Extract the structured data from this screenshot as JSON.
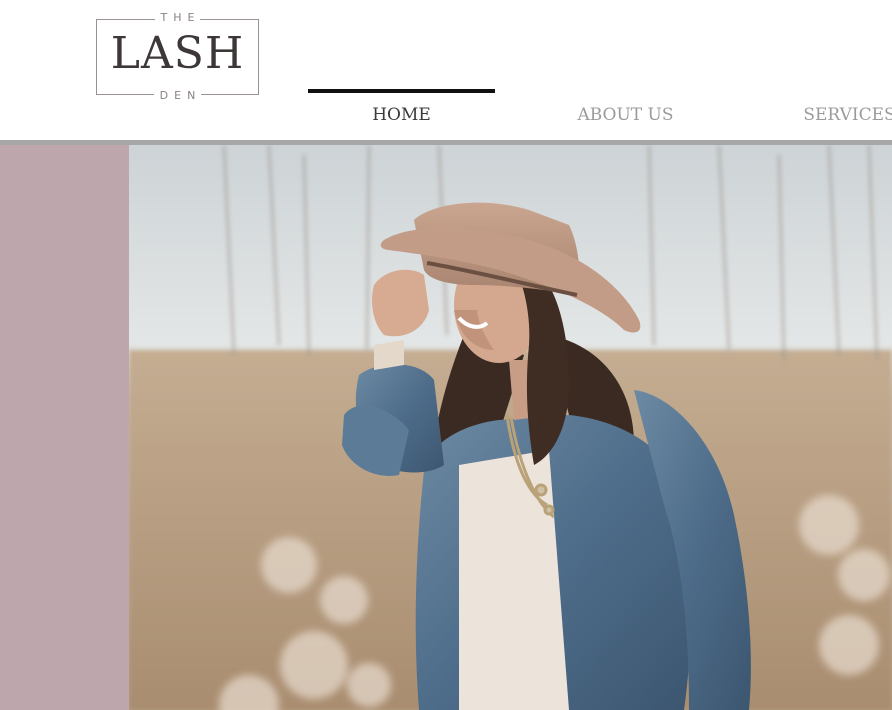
{
  "brand": {
    "logo_top": "THE",
    "logo_main": "LASH",
    "logo_bottom": "DEN"
  },
  "nav": {
    "items": [
      {
        "label": "HOME",
        "active": true
      },
      {
        "label": "ABOUT US",
        "active": false
      },
      {
        "label": "SERVICES",
        "active": false
      }
    ]
  },
  "colors": {
    "accent_panel": "#bda7ad",
    "nav_active_bar": "#111111",
    "header_rule": "#a7a7a7"
  },
  "hero": {
    "image": "woman-in-hat-and-denim-jacket-photo"
  }
}
